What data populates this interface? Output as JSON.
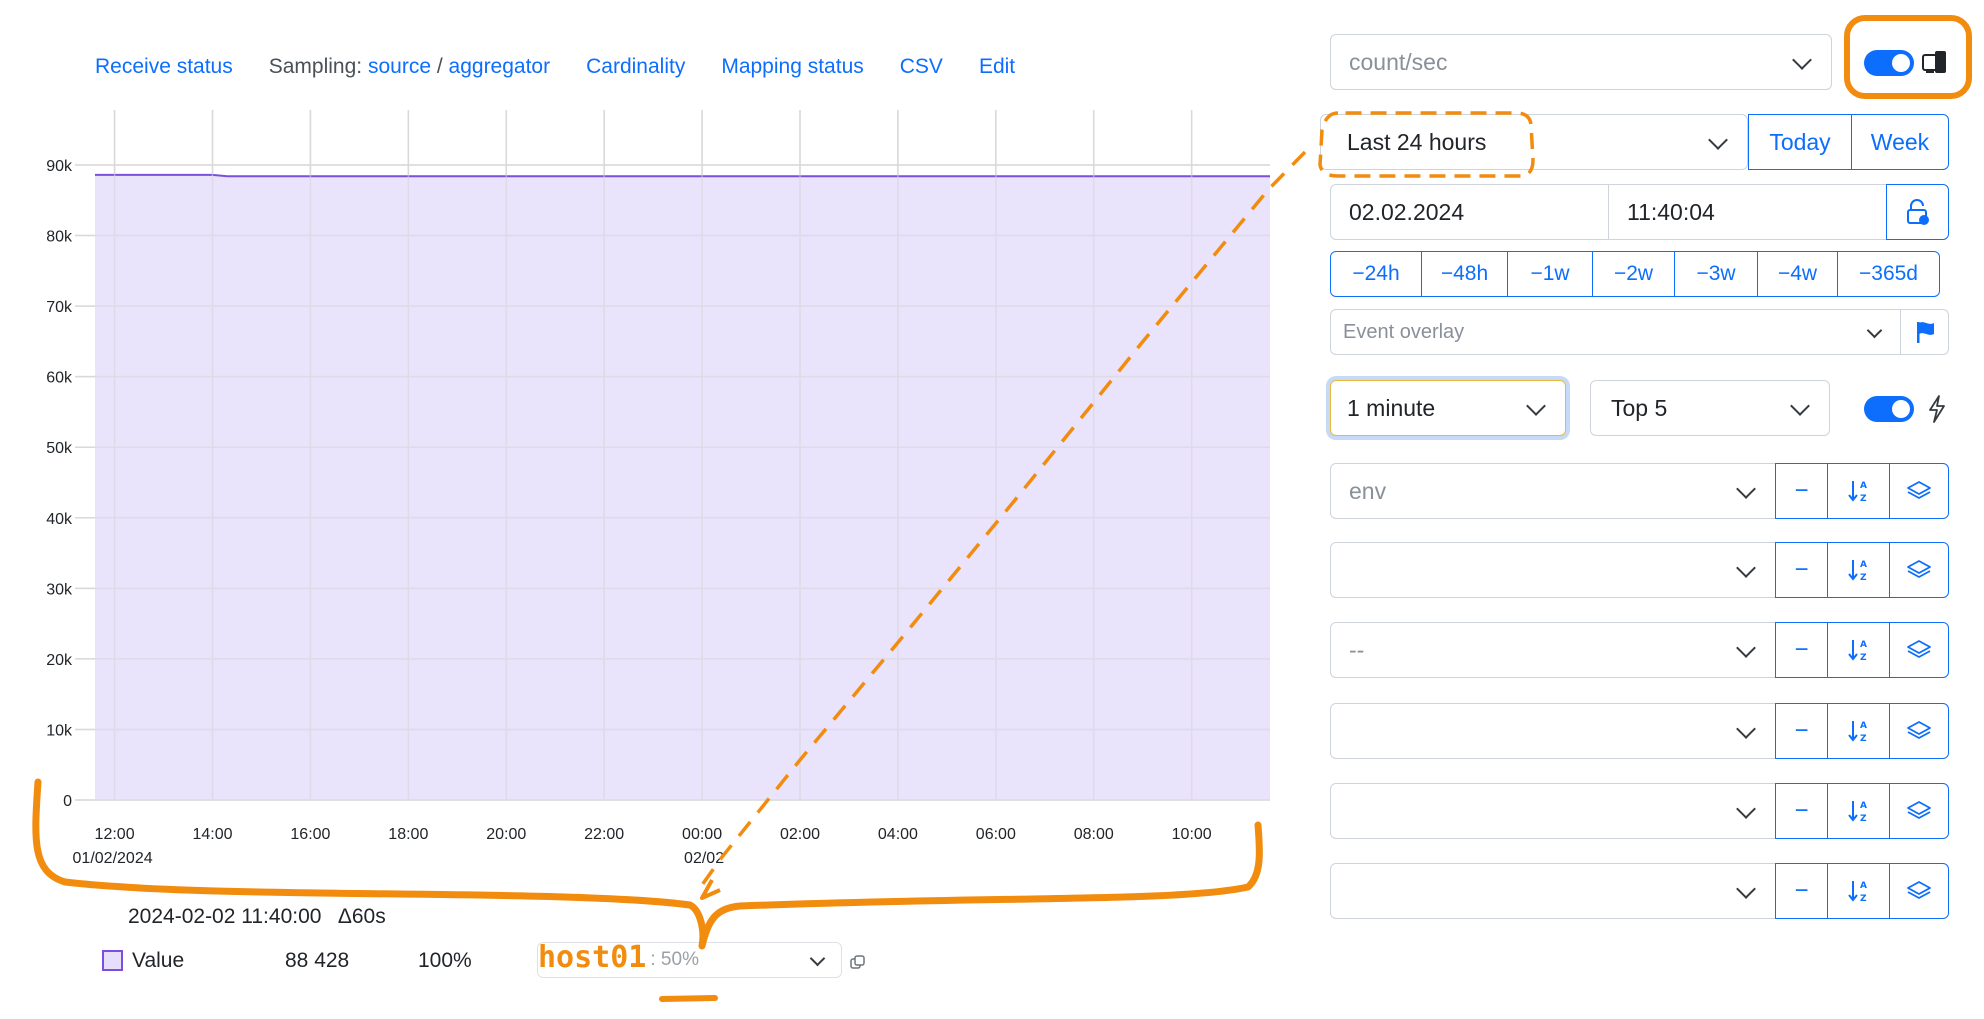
{
  "links": {
    "receive_status": "Receive status",
    "sampling_label": "Sampling:",
    "source": "source",
    "slash": "/",
    "aggregator": "aggregator",
    "cardinality": "Cardinality",
    "mapping_status": "Mapping status",
    "csv": "CSV",
    "edit": "Edit"
  },
  "chart_data": {
    "type": "area",
    "y_ticks": [
      "0",
      "10k",
      "20k",
      "30k",
      "40k",
      "50k",
      "60k",
      "70k",
      "80k",
      "90k"
    ],
    "ylim": [
      0,
      90000
    ],
    "x_ticks": [
      "12:00",
      "14:00",
      "16:00",
      "18:00",
      "20:00",
      "22:00",
      "00:00",
      "02:00",
      "04:00",
      "06:00",
      "08:00",
      "10:00"
    ],
    "x_dates": [
      "01/02/2024",
      "02/02"
    ],
    "x_hours_range": [
      11.6,
      35.6
    ],
    "grid": true,
    "series": [
      {
        "name": "Value",
        "color": "#7a4fe0",
        "fill": "#e6defc",
        "x_hours": [
          11.6,
          14.0,
          14.3,
          18.0,
          24.0,
          30.0,
          35.6
        ],
        "values": [
          88600,
          88600,
          88400,
          88400,
          88400,
          88400,
          88400
        ]
      }
    ]
  },
  "legend": {
    "timestamp": "2024-02-02 11:40:00",
    "delta": "Δ60s",
    "series_name": "Value",
    "series_value": "88 428",
    "series_percent": "100%",
    "host_label": "host01",
    "host_share": ": 50%"
  },
  "panel": {
    "metric_unit": "count/sec",
    "time_range": "Last 24 hours",
    "today_btn": "Today",
    "week_btn": "Week",
    "date": "02.02.2024",
    "time": "11:40:04",
    "shifts": [
      "−24h",
      "−48h",
      "−1w",
      "−2w",
      "−3w",
      "−4w",
      "−365d"
    ],
    "event_overlay": "Event overlay",
    "resolution": "1 minute",
    "top_n": "Top 5",
    "group_by": [
      {
        "value": "env"
      },
      {
        "value": ""
      },
      {
        "value": "--"
      },
      {
        "value": ""
      },
      {
        "value": ""
      },
      {
        "value": ""
      }
    ],
    "minus": "−"
  },
  "colors": {
    "accent": "#0d6efd",
    "annotation": "#f28c0f",
    "series_line": "#7a4fe0",
    "series_fill": "#e6defc"
  }
}
